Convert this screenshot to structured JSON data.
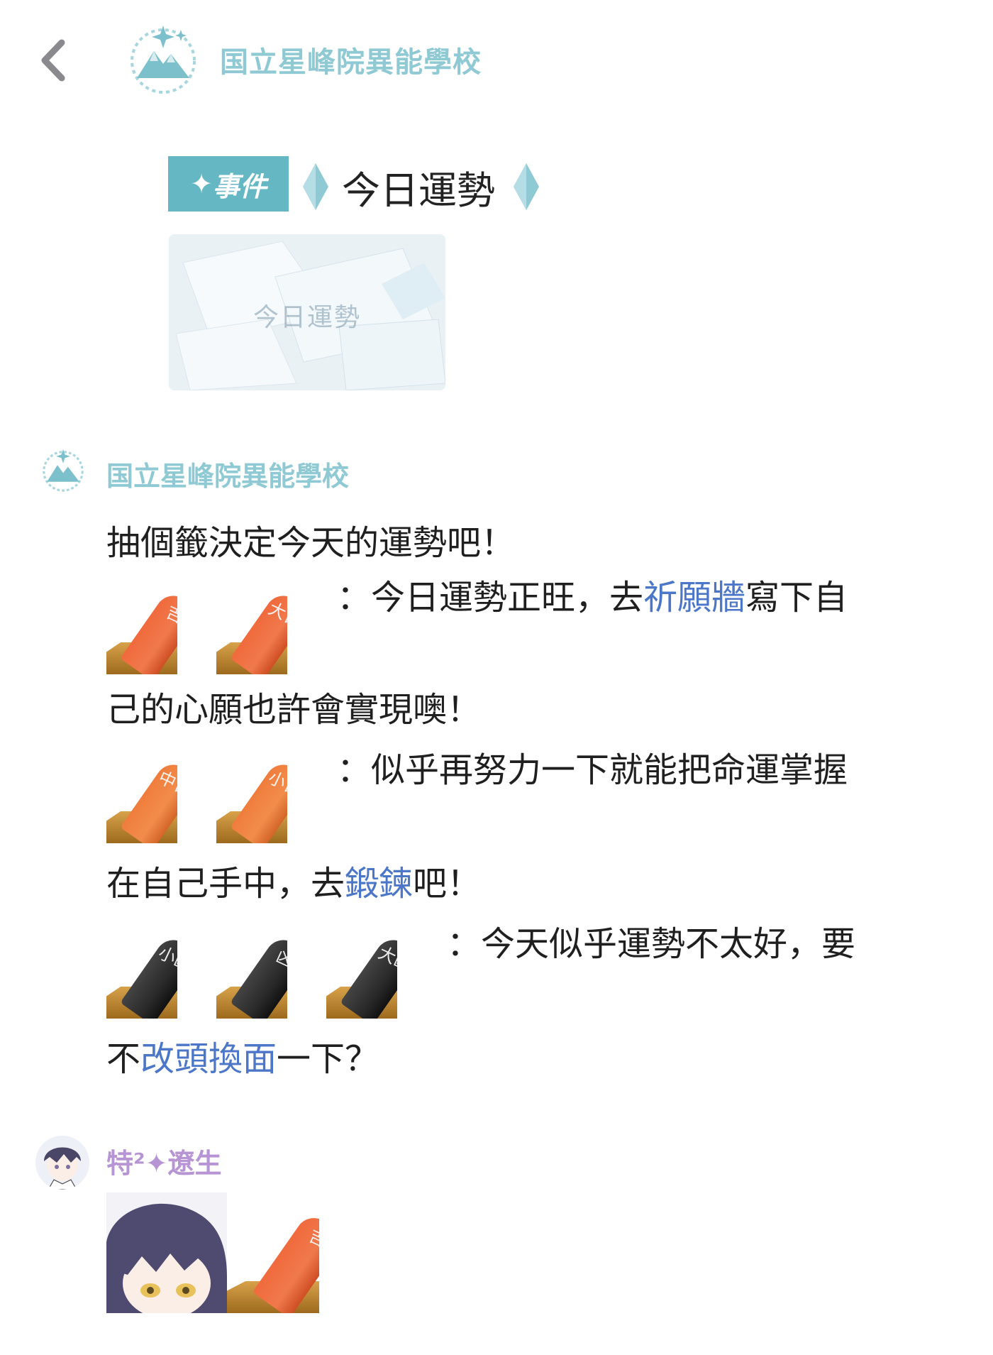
{
  "header": {
    "back_icon": "chevron-left-icon",
    "logo_icon": "mountain-laurel-logo-icon",
    "title": "国立星峰院異能學校"
  },
  "event": {
    "tag_label": "事件",
    "title": "今日運勢",
    "image_caption": "今日運勢"
  },
  "post1": {
    "author": "国立星峰院異能學校",
    "intro": "抽個籤決定今天的運勢吧！",
    "good": {
      "sticks": [
        "吉",
        "大吉"
      ],
      "text_pre": "：今日運勢正旺，去",
      "link": "祈願牆",
      "text_post": "寫下自",
      "text_cont": "己的心願也許會實現噢！"
    },
    "middle": {
      "sticks": [
        "中吉",
        "小吉"
      ],
      "text_a": "：似乎再努力一下就能把命運掌握",
      "text_b_pre": "在自己手中，去",
      "link": "鍛鍊",
      "text_b_post": "吧！"
    },
    "bad": {
      "sticks": [
        "小凶",
        "凶",
        "大凶"
      ],
      "text_a": "：今天似乎運勢不太好，要",
      "text_b_pre": "不",
      "link": "改頭換面",
      "text_b_post": "一下？"
    }
  },
  "post2": {
    "author": "特²✦遼生",
    "sticker_stick": "吉"
  },
  "colors": {
    "school_teal": "#8ec9d4",
    "event_tag_bg": "#66b7c4",
    "link_blue": "#4c77c9",
    "user_purple": "#b794d3"
  }
}
